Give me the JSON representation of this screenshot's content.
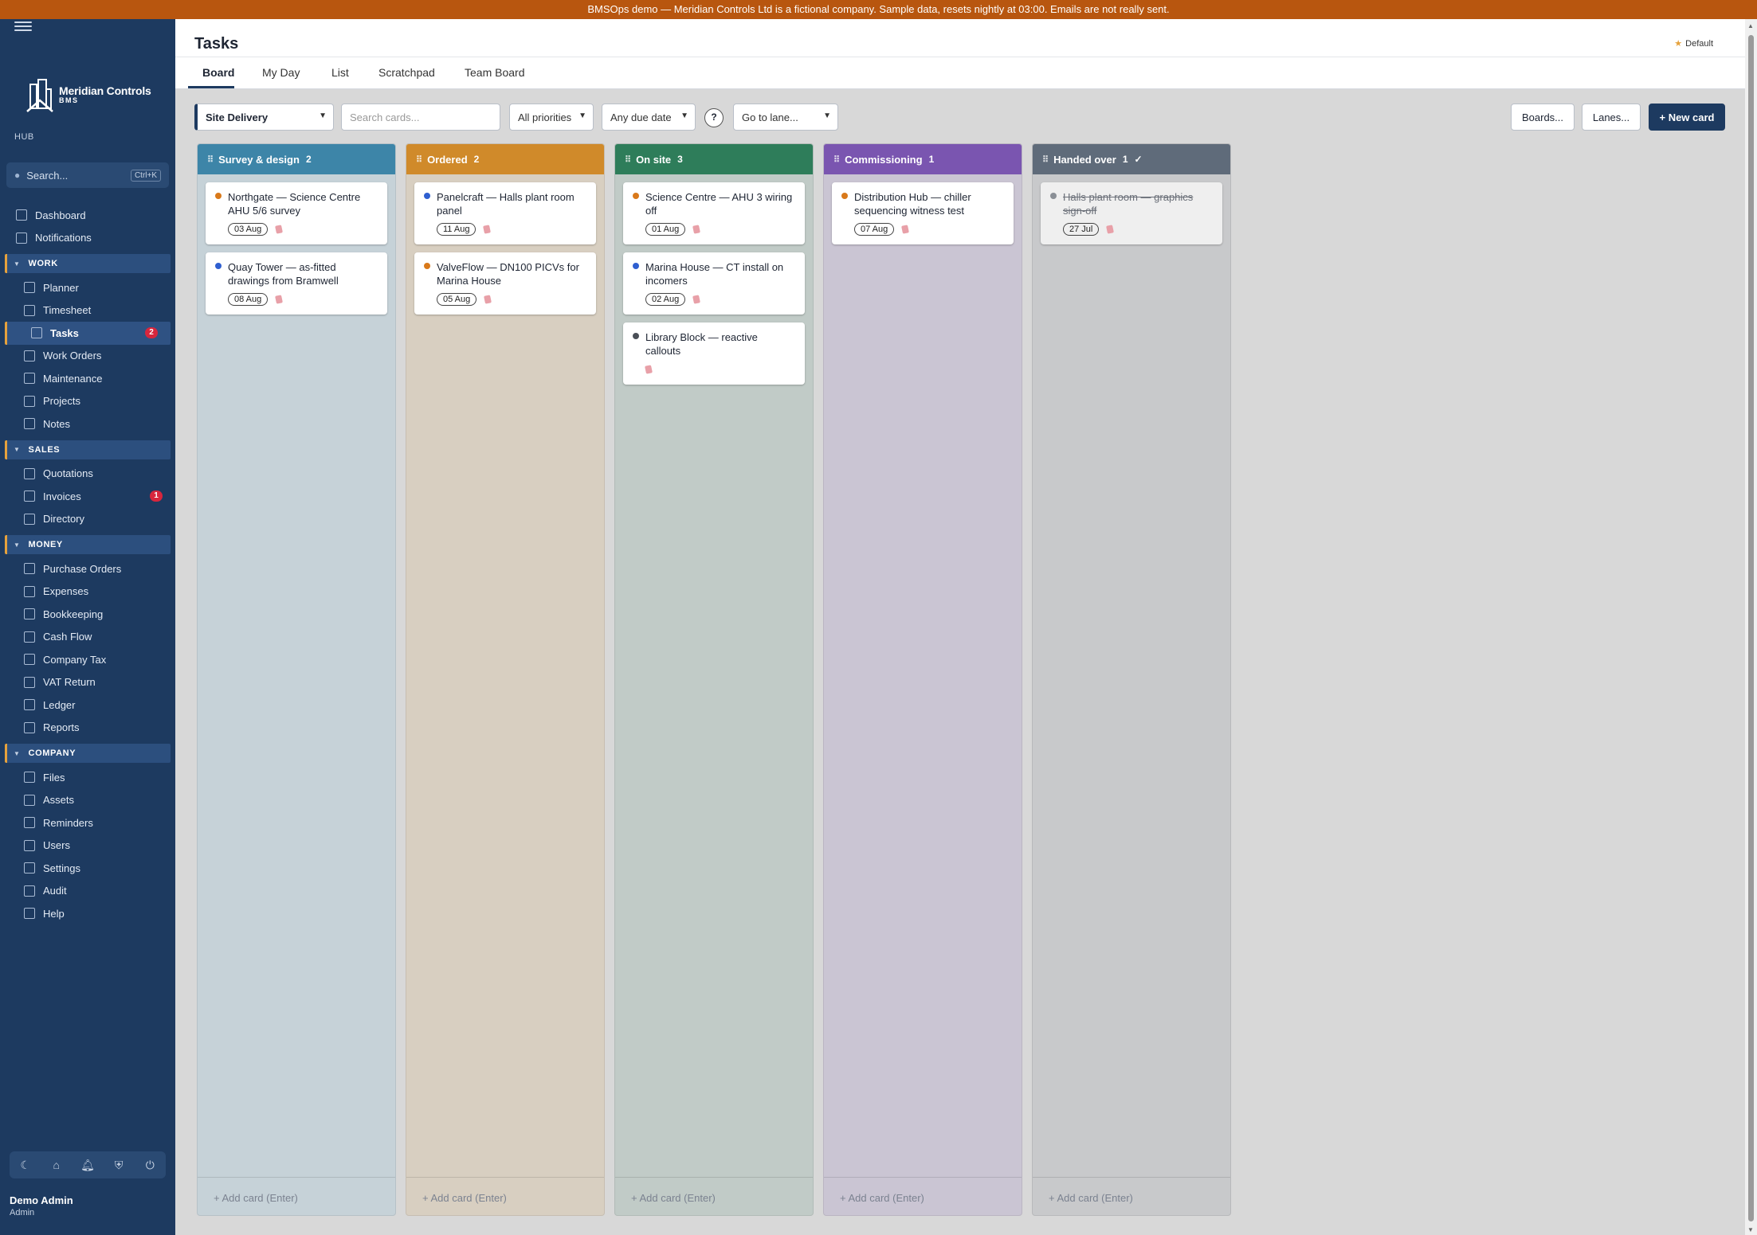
{
  "banner": "BMSOps demo — Meridian Controls Ltd is a fictional company. Sample data, resets nightly at 03:00. Emails are not really sent.",
  "brand": {
    "name": "Meridian Controls",
    "sub": "BMS",
    "hub": "HUB"
  },
  "search": {
    "placeholder": "Search...",
    "shortcut": "Ctrl+K"
  },
  "nav": {
    "top": [
      {
        "label": "Dashboard"
      },
      {
        "label": "Notifications"
      }
    ],
    "work_label": "WORK",
    "work": [
      {
        "label": "Planner"
      },
      {
        "label": "Timesheet"
      },
      {
        "label": "Tasks",
        "badge": "2"
      },
      {
        "label": "Work Orders"
      },
      {
        "label": "Maintenance"
      },
      {
        "label": "Projects"
      },
      {
        "label": "Notes"
      }
    ],
    "sales_label": "SALES",
    "sales": [
      {
        "label": "Quotations"
      },
      {
        "label": "Invoices",
        "badge": "1"
      },
      {
        "label": "Directory"
      }
    ],
    "money_label": "MONEY",
    "money": [
      {
        "label": "Purchase Orders"
      },
      {
        "label": "Expenses"
      },
      {
        "label": "Bookkeeping"
      },
      {
        "label": "Cash Flow"
      },
      {
        "label": "Company Tax"
      },
      {
        "label": "VAT Return"
      },
      {
        "label": "Ledger"
      },
      {
        "label": "Reports"
      }
    ],
    "company_label": "COMPANY",
    "company": [
      {
        "label": "Files"
      },
      {
        "label": "Assets"
      },
      {
        "label": "Reminders"
      },
      {
        "label": "Users"
      },
      {
        "label": "Settings"
      },
      {
        "label": "Audit"
      },
      {
        "label": "Help"
      }
    ]
  },
  "user": {
    "name": "Demo Admin",
    "role": "Admin"
  },
  "page": {
    "title": "Tasks",
    "favourite": "Default"
  },
  "tabs": [
    "Board",
    "My Day",
    "List",
    "Scratchpad",
    "Team Board"
  ],
  "toolbar": {
    "board": "Site Delivery",
    "search_placeholder": "Search cards...",
    "priority": "All priorities",
    "due": "Any due date",
    "help": "?",
    "goto": "Go to lane...",
    "boards_btn": "Boards...",
    "lanes_btn": "Lanes...",
    "new_card_btn": "+ New card"
  },
  "colors": {
    "accent": "#1d3a60",
    "banner": "#b8560f",
    "priority_high": "#d9791a",
    "priority_med": "#2f5fd0",
    "priority_low": "#4a4f57"
  },
  "lanes": [
    {
      "name": "Survey & design",
      "count": "2",
      "head": "#3d85a8",
      "bg": "#c6d2d8",
      "add": "+ Add card (Enter)",
      "cards": [
        {
          "title": "Northgate — Science Centre AHU 5/6 survey",
          "date": "03 Aug",
          "priority": "#d9791a"
        },
        {
          "title": "Quay Tower — as-fitted drawings from Bramwell",
          "date": "08 Aug",
          "priority": "#2f5fd0"
        }
      ]
    },
    {
      "name": "Ordered",
      "count": "2",
      "head": "#d08a2a",
      "bg": "#d8cfc1",
      "add": "+ Add card (Enter)",
      "cards": [
        {
          "title": "Panelcraft — Halls plant room panel",
          "date": "11 Aug",
          "priority": "#2f5fd0"
        },
        {
          "title": "ValveFlow — DN100 PICVs for Marina House",
          "date": "05 Aug",
          "priority": "#d9791a"
        }
      ]
    },
    {
      "name": "On site",
      "count": "3",
      "head": "#2e7d5a",
      "bg": "#c1cbc7",
      "add": "+ Add card (Enter)",
      "cards": [
        {
          "title": "Science Centre — AHU 3 wiring off",
          "date": "01 Aug",
          "priority": "#d9791a"
        },
        {
          "title": "Marina House — CT install on incomers",
          "date": "02 Aug",
          "priority": "#2f5fd0"
        },
        {
          "title": "Library Block — reactive callouts",
          "date": "",
          "priority": "#4a4f57"
        }
      ]
    },
    {
      "name": "Commissioning",
      "count": "1",
      "head": "#7a55b0",
      "bg": "#cac5d3",
      "add": "+ Add card (Enter)",
      "cards": [
        {
          "title": "Distribution Hub — chiller sequencing witness test",
          "date": "07 Aug",
          "priority": "#d9791a"
        }
      ]
    },
    {
      "name": "Handed over",
      "count": "1",
      "check": "✓",
      "head": "#5f6b7a",
      "bg": "#c8c9cb",
      "add": "+ Add card (Enter)",
      "cards": [
        {
          "title": "Halls plant room — graphics sign-off",
          "date": "27 Jul",
          "priority": "#8a8f96",
          "done": true
        }
      ]
    }
  ]
}
